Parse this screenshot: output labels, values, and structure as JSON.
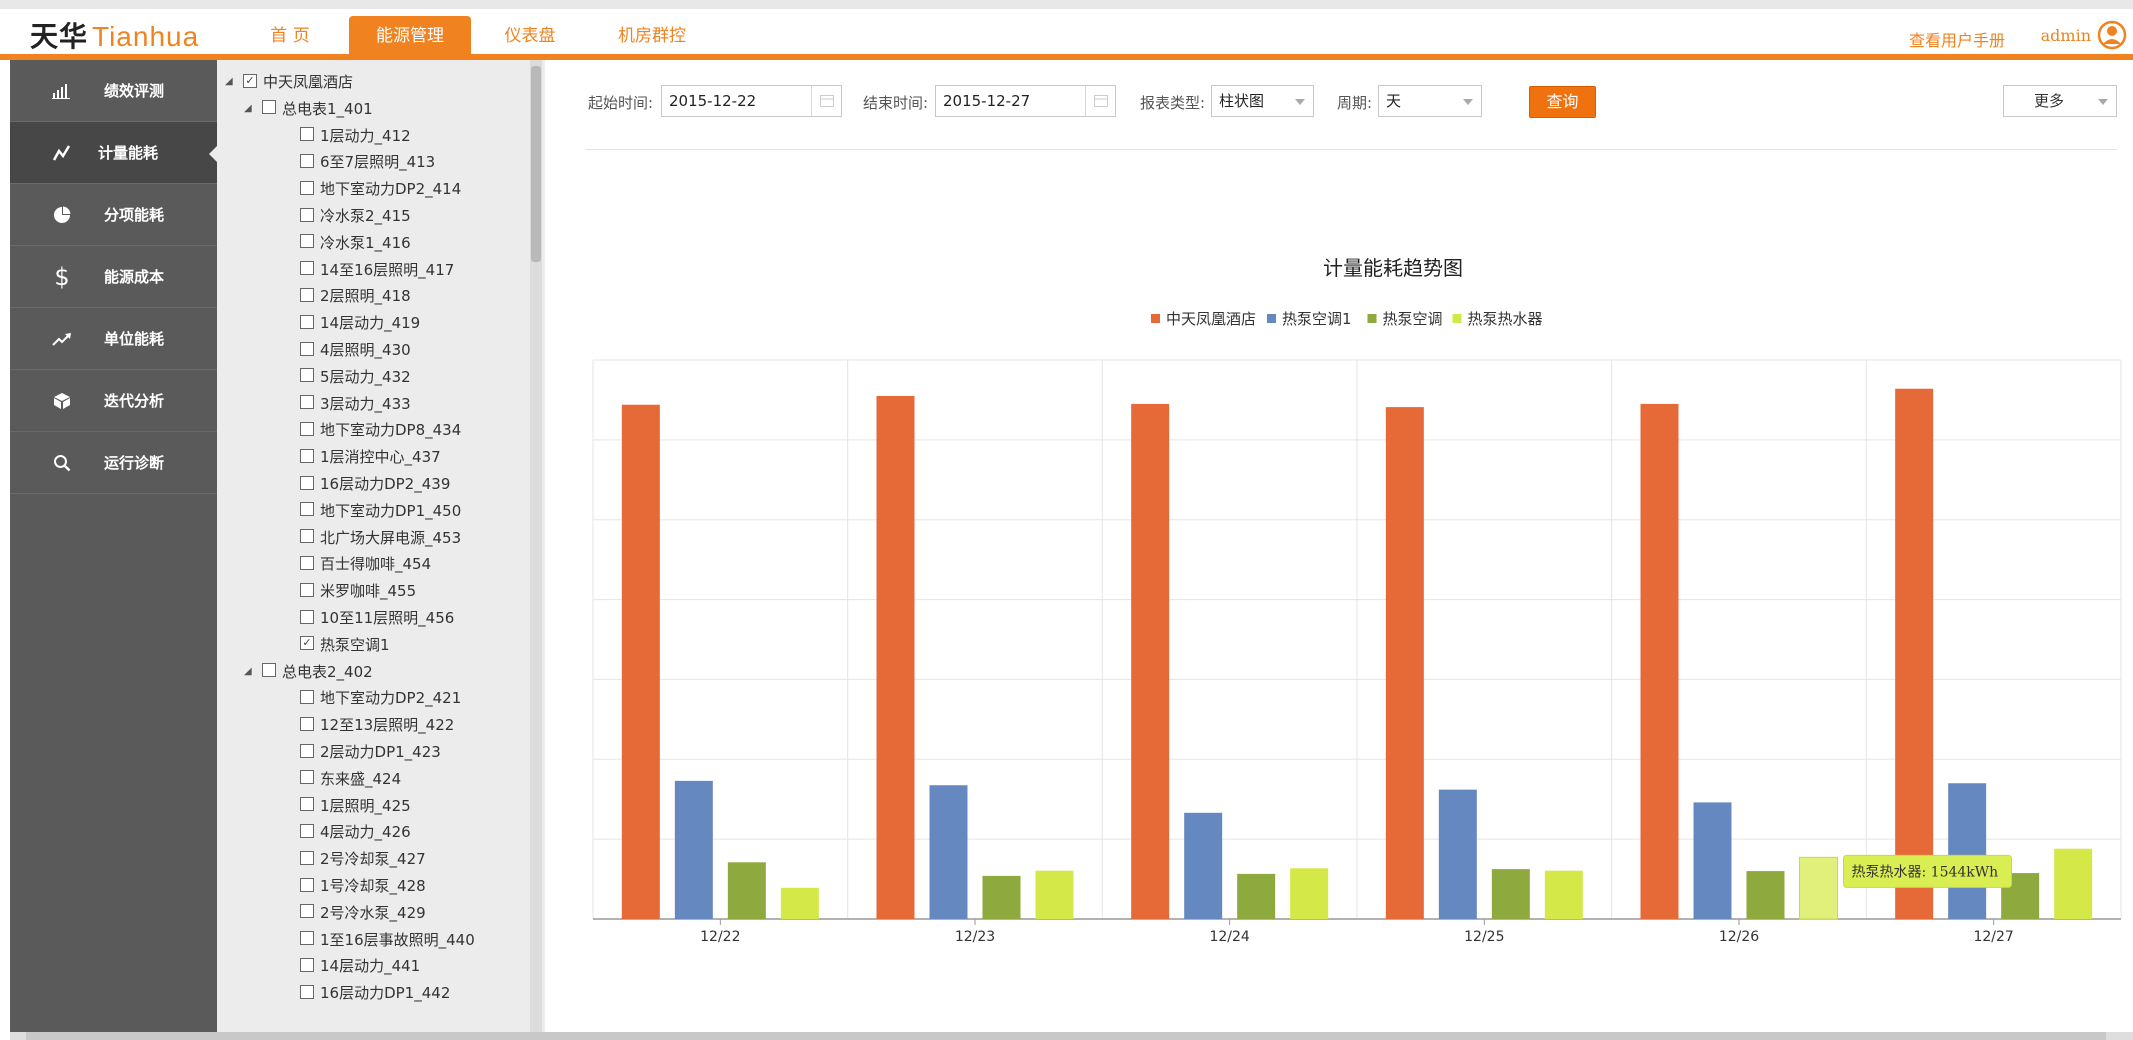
{
  "header": {
    "logo_cn": "天华",
    "logo_en": "Tianhua",
    "tabs": [
      {
        "label": "首 页",
        "active": false
      },
      {
        "label": "能源管理",
        "active": true
      },
      {
        "label": "仪表盘",
        "active": false
      },
      {
        "label": "机房群控",
        "active": false
      }
    ],
    "manual_link": "查看用户手册",
    "user": "admin",
    "accent_color": "#f0831f"
  },
  "sidebar": {
    "items": [
      {
        "label": "绩效评测",
        "icon": "bar-chart-icon",
        "active": false
      },
      {
        "label": "计量能耗",
        "icon": "line-trend-icon",
        "active": true
      },
      {
        "label": "分项能耗",
        "icon": "pie-chart-icon",
        "active": false
      },
      {
        "label": "能源成本",
        "icon": "dollar-icon",
        "active": false
      },
      {
        "label": "单位能耗",
        "icon": "trend-up-icon",
        "active": false
      },
      {
        "label": "迭代分析",
        "icon": "cube-icon",
        "active": false
      },
      {
        "label": "运行诊断",
        "icon": "search-icon",
        "active": false
      }
    ]
  },
  "tree": {
    "root": {
      "label": "中天凤凰酒店",
      "checked": true
    },
    "groups": [
      {
        "label": "总电表1_401",
        "checked": false,
        "children": [
          {
            "label": "1层动力_412",
            "checked": false
          },
          {
            "label": "6至7层照明_413",
            "checked": false
          },
          {
            "label": "地下室动力DP2_414",
            "checked": false
          },
          {
            "label": "冷水泵2_415",
            "checked": false
          },
          {
            "label": "冷水泵1_416",
            "checked": false
          },
          {
            "label": "14至16层照明_417",
            "checked": false
          },
          {
            "label": "2层照明_418",
            "checked": false
          },
          {
            "label": "14层动力_419",
            "checked": false
          },
          {
            "label": "4层照明_430",
            "checked": false
          },
          {
            "label": "5层动力_432",
            "checked": false
          },
          {
            "label": "3层动力_433",
            "checked": false
          },
          {
            "label": "地下室动力DP8_434",
            "checked": false
          },
          {
            "label": "1层消控中心_437",
            "checked": false
          },
          {
            "label": "16层动力DP2_439",
            "checked": false
          },
          {
            "label": "地下室动力DP1_450",
            "checked": false
          },
          {
            "label": "北广场大屏电源_453",
            "checked": false
          },
          {
            "label": "百士得咖啡_454",
            "checked": false
          },
          {
            "label": "米罗咖啡_455",
            "checked": false
          },
          {
            "label": "10至11层照明_456",
            "checked": false
          },
          {
            "label": "热泵空调1",
            "checked": true
          }
        ]
      },
      {
        "label": "总电表2_402",
        "checked": false,
        "children": [
          {
            "label": "地下室动力DP2_421",
            "checked": false
          },
          {
            "label": "12至13层照明_422",
            "checked": false
          },
          {
            "label": "2层动力DP1_423",
            "checked": false
          },
          {
            "label": "东来盛_424",
            "checked": false
          },
          {
            "label": "1层照明_425",
            "checked": false
          },
          {
            "label": "4层动力_426",
            "checked": false
          },
          {
            "label": "2号冷却泵_427",
            "checked": false
          },
          {
            "label": "1号冷却泵_428",
            "checked": false
          },
          {
            "label": "2号冷水泵_429",
            "checked": false
          },
          {
            "label": "1至16层事故照明_440",
            "checked": false
          },
          {
            "label": "14层动力_441",
            "checked": false
          },
          {
            "label": "16层动力DP1_442",
            "checked": false
          }
        ]
      }
    ]
  },
  "filters": {
    "start_label": "起始时间:",
    "start_value": "2015-12-22",
    "end_label": "结束时间:",
    "end_value": "2015-12-27",
    "report_label": "报表类型:",
    "report_value": "柱状图",
    "period_label": "周期:",
    "period_value": "天",
    "query_button": "查询",
    "more_select": "更多"
  },
  "chart_data": {
    "type": "bar",
    "title": "计量能耗趋势图",
    "categories": [
      "12/22",
      "12/23",
      "12/24",
      "12/25",
      "12/26",
      "12/27"
    ],
    "series": [
      {
        "name": "中天凤凰酒店",
        "color": "#e56a37",
        "values": [
          12880,
          13100,
          12900,
          12820,
          12900,
          13280
        ]
      },
      {
        "name": "热泵空调1",
        "color": "#6688c0",
        "values": [
          3460,
          3350,
          2660,
          3240,
          2920,
          3400
        ]
      },
      {
        "name": "热泵空调",
        "color": "#8eaa3e",
        "values": [
          1420,
          1080,
          1130,
          1250,
          1200,
          1150
        ]
      },
      {
        "name": "热泵热水器",
        "color": "#d4e848",
        "values": [
          780,
          1210,
          1270,
          1210,
          1544,
          1760
        ]
      }
    ],
    "ylim": [
      0,
      14000
    ],
    "grid": true,
    "legend_position": "top-center",
    "tooltip": {
      "text": "热泵热水器: 1544kWh",
      "category": "12/26",
      "series": "热泵热水器"
    }
  }
}
